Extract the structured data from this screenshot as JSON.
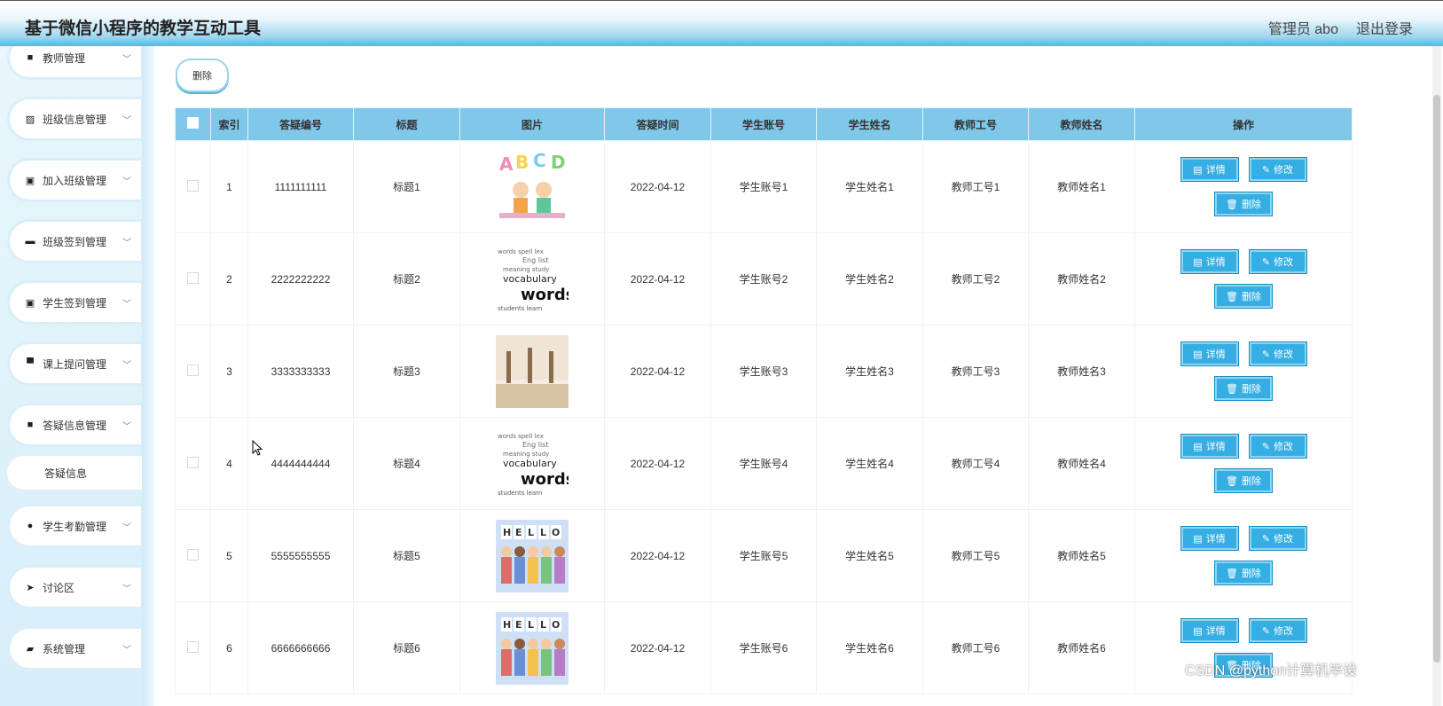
{
  "header": {
    "title": "基于微信小程序的教学互动工具",
    "user": "管理员 abo",
    "logout": "退出登录"
  },
  "sidebar": {
    "items": [
      {
        "label": "教师管理",
        "icon": "grid-icon"
      },
      {
        "label": "班级信息管理",
        "icon": "chart-icon"
      },
      {
        "label": "加入班级管理",
        "icon": "clipboard-icon"
      },
      {
        "label": "班级签到管理",
        "icon": "ticket-icon"
      },
      {
        "label": "学生签到管理",
        "icon": "clipboard-check-icon"
      },
      {
        "label": "课上提问管理",
        "icon": "comment-icon"
      },
      {
        "label": "答疑信息管理",
        "icon": "grid-icon"
      },
      {
        "label": "学生考勤管理",
        "icon": "location-icon"
      },
      {
        "label": "讨论区",
        "icon": "send-icon"
      },
      {
        "label": "系统管理",
        "icon": "briefcase-icon"
      }
    ],
    "submenu": {
      "label": "答疑信息"
    }
  },
  "toolbar": {
    "delete_label": "删除"
  },
  "table": {
    "headers": [
      "索引",
      "答疑编号",
      "标题",
      "图片",
      "答疑时间",
      "学生账号",
      "学生姓名",
      "教师工号",
      "教师姓名",
      "操作"
    ],
    "rows": [
      {
        "index": "1",
        "code": "1111111111",
        "title": "标题1",
        "image": "abcd-kids-image",
        "time": "2022-04-12",
        "student_account": "学生账号1",
        "student_name": "学生姓名1",
        "teacher_id": "教师工号1",
        "teacher_name": "教师姓名1"
      },
      {
        "index": "2",
        "code": "2222222222",
        "title": "标题2",
        "image": "vocabulary-words-image",
        "time": "2022-04-12",
        "student_account": "学生账号2",
        "student_name": "学生姓名2",
        "teacher_id": "教师工号2",
        "teacher_name": "教师姓名2"
      },
      {
        "index": "3",
        "code": "3333333333",
        "title": "标题3",
        "image": "dance-class-image",
        "time": "2022-04-12",
        "student_account": "学生账号3",
        "student_name": "学生姓名3",
        "teacher_id": "教师工号3",
        "teacher_name": "教师姓名3"
      },
      {
        "index": "4",
        "code": "4444444444",
        "title": "标题4",
        "image": "vocabulary-words-image",
        "time": "2022-04-12",
        "student_account": "学生账号4",
        "student_name": "学生姓名4",
        "teacher_id": "教师工号4",
        "teacher_name": "教师姓名4"
      },
      {
        "index": "5",
        "code": "5555555555",
        "title": "标题5",
        "image": "hello-kids-image",
        "time": "2022-04-12",
        "student_account": "学生账号5",
        "student_name": "学生姓名5",
        "teacher_id": "教师工号5",
        "teacher_name": "教师姓名5"
      },
      {
        "index": "6",
        "code": "6666666666",
        "title": "标题6",
        "image": "hello-kids-image",
        "time": "2022-04-12",
        "student_account": "学生账号6",
        "student_name": "学生姓名6",
        "teacher_id": "教师工号6",
        "teacher_name": "教师姓名6"
      }
    ],
    "actions": {
      "detail": "详情",
      "edit": "修改",
      "delete": "删除"
    }
  },
  "watermark": "CSDN @python计算机毕设",
  "colors": {
    "accent": "#35aee3",
    "header_bg": "#7fc8ea"
  }
}
